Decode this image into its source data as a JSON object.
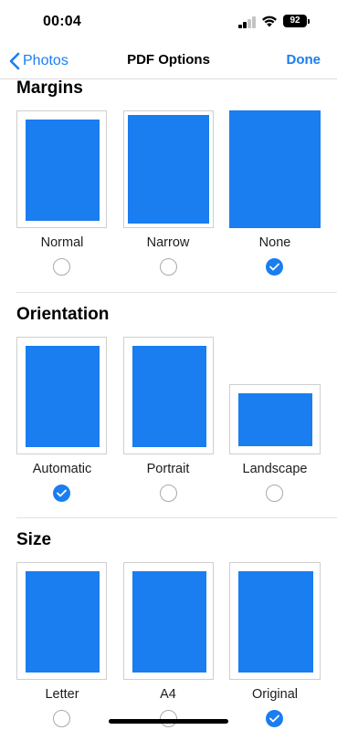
{
  "status": {
    "time": "00:04",
    "battery": "92"
  },
  "nav": {
    "back_label": "Photos",
    "title": "PDF Options",
    "done_label": "Done"
  },
  "sections": {
    "margins": {
      "title": "Margins",
      "options": [
        {
          "label": "Normal",
          "selected": false
        },
        {
          "label": "Narrow",
          "selected": false
        },
        {
          "label": "None",
          "selected": true
        }
      ]
    },
    "orientation": {
      "title": "Orientation",
      "options": [
        {
          "label": "Automatic",
          "selected": true
        },
        {
          "label": "Portrait",
          "selected": false
        },
        {
          "label": "Landscape",
          "selected": false
        }
      ]
    },
    "size": {
      "title": "Size",
      "options": [
        {
          "label": "Letter",
          "selected": false
        },
        {
          "label": "A4",
          "selected": false
        },
        {
          "label": "Original",
          "selected": true
        }
      ]
    }
  },
  "colors": {
    "accent": "#1a7df0",
    "page": "#1a7df0"
  }
}
